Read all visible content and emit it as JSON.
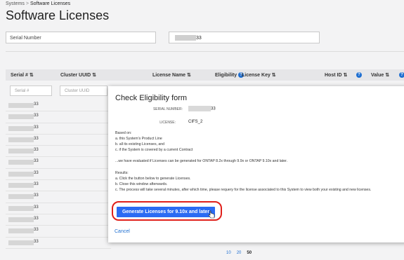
{
  "breadcrumb": {
    "parent": "Systems",
    "separator": ">",
    "current": "Software Licenses"
  },
  "page": {
    "title": "Software Licenses"
  },
  "filter": {
    "select_value": "Serial Number",
    "input_suffix": "33"
  },
  "table": {
    "headers": {
      "serial": "Serial # ⇅",
      "cluster": "Cluster UUID ⇅",
      "license_name": "License Name ⇅",
      "eligibility": "Eligibility",
      "license_key": "License Key ⇅",
      "host_id": "Host ID ⇅",
      "value": "Value ⇅"
    },
    "filter_placeholders": {
      "serial": "Serial #",
      "cluster": "Cluster UUID"
    },
    "row_suffix": "33"
  },
  "pagination": {
    "p10": "10",
    "p20": "20",
    "p50": "50"
  },
  "modal": {
    "title": "Check Eligibility form",
    "serial_label": "SERIAL NUMBER:",
    "serial_suffix": "33",
    "license_label": "LICENSE:",
    "license_value": "CIFS_2",
    "based_on": "Based on:",
    "point_a": "a. this System's Product Line",
    "point_b": "b. all its existing Licenses, and",
    "point_c": "c. if the System is covered by a current Contract",
    "evaluated": "...we have evaluated if Licenses can be generated for ONTAP 8.2x through 9.9x or ONTAP 9.10x and later.",
    "results": "Results:",
    "result_a": "a. Click the button below to generate Licenses.",
    "result_b": "b. Close this window afterwards.",
    "result_c": "c. The process will take several minutes, after which time, please requery for the license associated to this System to view both your existing and new licenses.",
    "generate_label": "Generate Licenses for 9.10x and later",
    "cancel_label": "Cancel"
  },
  "colors": {
    "accent": "#2b6bf3",
    "highlight": "#e0201b",
    "link": "#1f6fd1"
  }
}
